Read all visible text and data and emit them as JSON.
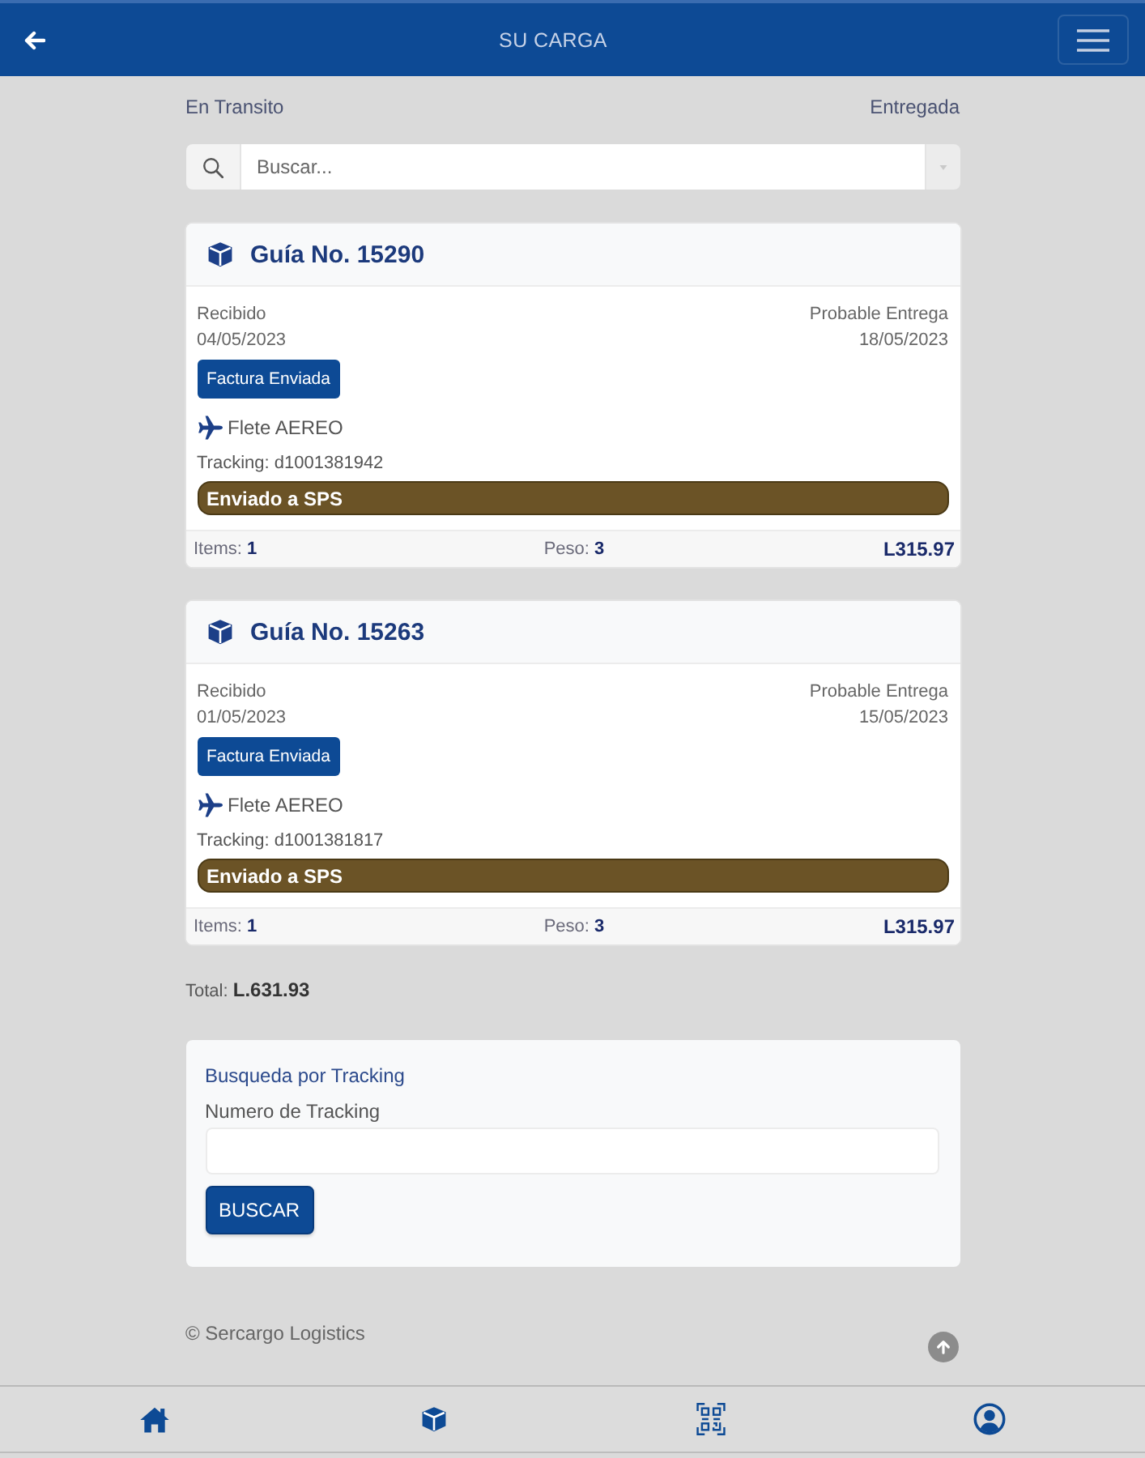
{
  "header": {
    "title": "SU CARGA"
  },
  "status_tabs": [
    {
      "label": "En Transito",
      "selected": false
    },
    {
      "label": "Entregada",
      "selected": false
    }
  ],
  "search": {
    "placeholder": "Buscar..."
  },
  "guides": [
    {
      "title": "Guía No. 15290",
      "received_label": "Recibido",
      "received_date": "04/05/2023",
      "delivery_label": "Probable Entrega",
      "delivery_date": "18/05/2023",
      "badge": "Factura Enviada",
      "freight": "Flete AEREO",
      "tracking": "Tracking: d1001381942",
      "status": "Enviado a SPS",
      "items_label": "Items:",
      "items": "1",
      "weight_label": "Peso:",
      "weight": "3",
      "amount": "L315.97"
    },
    {
      "title": "Guía No. 15263",
      "received_label": "Recibido",
      "received_date": "01/05/2023",
      "delivery_label": "Probable Entrega",
      "delivery_date": "15/05/2023",
      "badge": "Factura Enviada",
      "freight": "Flete AEREO",
      "tracking": "Tracking: d1001381817",
      "status": "Enviado a SPS",
      "items_label": "Items:",
      "items": "1",
      "weight_label": "Peso:",
      "weight": "3",
      "amount": "L315.97"
    }
  ],
  "total": {
    "label": "Total:",
    "value": "L.631.93"
  },
  "tracking_search": {
    "title": "Busqueda por Tracking",
    "field_label": "Numero de Tracking",
    "button": "BUSCAR"
  },
  "footer": {
    "copyright": "© Sercargo Logistics"
  },
  "bottom_nav": [
    {
      "kind": "home"
    },
    {
      "kind": "box"
    },
    {
      "kind": "qr"
    },
    {
      "kind": "user"
    }
  ]
}
